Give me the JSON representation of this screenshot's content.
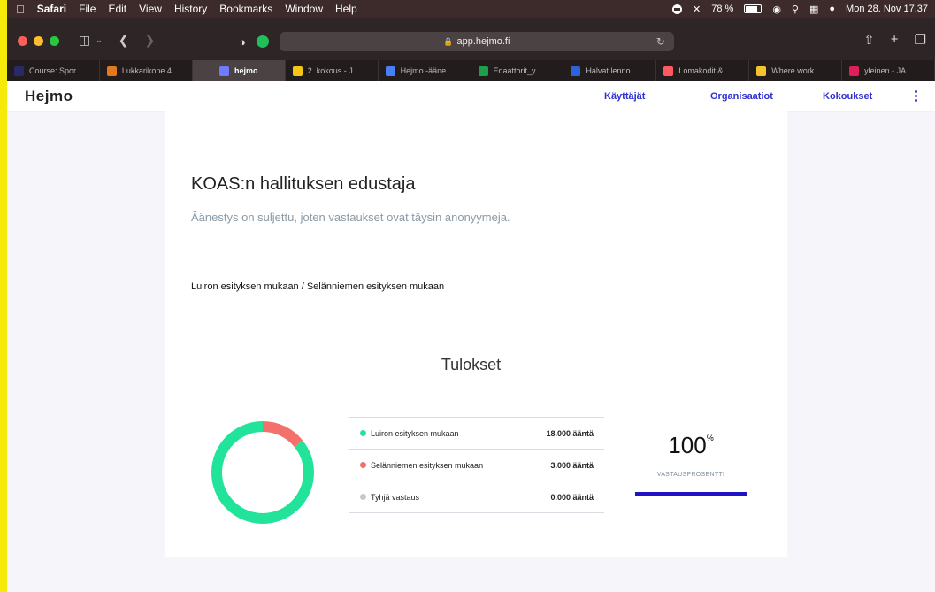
{
  "colors": {
    "accent": "#2f2fd0",
    "green": "#21e39a",
    "red": "#f4706a",
    "gray": "#c4c7cf",
    "progress": "#1f12c8",
    "frame": "#f6ea0a"
  },
  "menubar": {
    "app": "Safari",
    "items": [
      "File",
      "Edit",
      "View",
      "History",
      "Bookmarks",
      "Window",
      "Help"
    ],
    "battery": "78 %",
    "datetime": "Mon 28. Nov 17.37"
  },
  "browser": {
    "url": "app.hejmo.fi"
  },
  "tabs": [
    {
      "label": "Course: Spor...",
      "icon_color": "#2a2a6a"
    },
    {
      "label": "Lukkarikone 4",
      "icon_color": "#e2791c"
    },
    {
      "label": "hejmo",
      "icon_color": "#6f7cff"
    },
    {
      "label": "2. kokous - J...",
      "icon_color": "#f5c518"
    },
    {
      "label": "Hejmo -ääne...",
      "icon_color": "#4a7ef5"
    },
    {
      "label": "Edaattorit_y...",
      "icon_color": "#1e9e4a"
    },
    {
      "label": "Halvat lenno...",
      "icon_color": "#2c64d8"
    },
    {
      "label": "Lomakodit &...",
      "icon_color": "#ff5a5f"
    },
    {
      "label": "Where work...",
      "icon_color": "#f4c430"
    },
    {
      "label": "yleinen - JA...",
      "icon_color": "#e01e5a"
    }
  ],
  "app": {
    "logo": "Hejmo",
    "nav": {
      "users": "Käyttäjät",
      "organizations": "Organisaatiot",
      "meetings": "Kokoukset"
    }
  },
  "poll": {
    "title": "KOAS:n hallituksen edustaja",
    "subtitle": "Äänestys on suljettu, joten vastaukset ovat täysin anonyymeja.",
    "question": "Luiron esityksen mukaan / Selänniemen esityksen mukaan",
    "results_title": "Tulokset",
    "options": [
      {
        "label": "Luiron esityksen mukaan",
        "votes": "18.000 ääntä",
        "value": 18,
        "color": "#21e39a"
      },
      {
        "label": "Selänniemen esityksen mukaan",
        "votes": "3.000 ääntä",
        "value": 3,
        "color": "#f4706a"
      },
      {
        "label": "Tyhjä vastaus",
        "votes": "0.000 ääntä",
        "value": 0,
        "color": "#c4c7cf"
      }
    ],
    "response_rate": "100",
    "response_rate_unit": "%",
    "response_rate_label": "VASTAUSPROSENTTI",
    "response_rate_fraction": 1.0
  }
}
